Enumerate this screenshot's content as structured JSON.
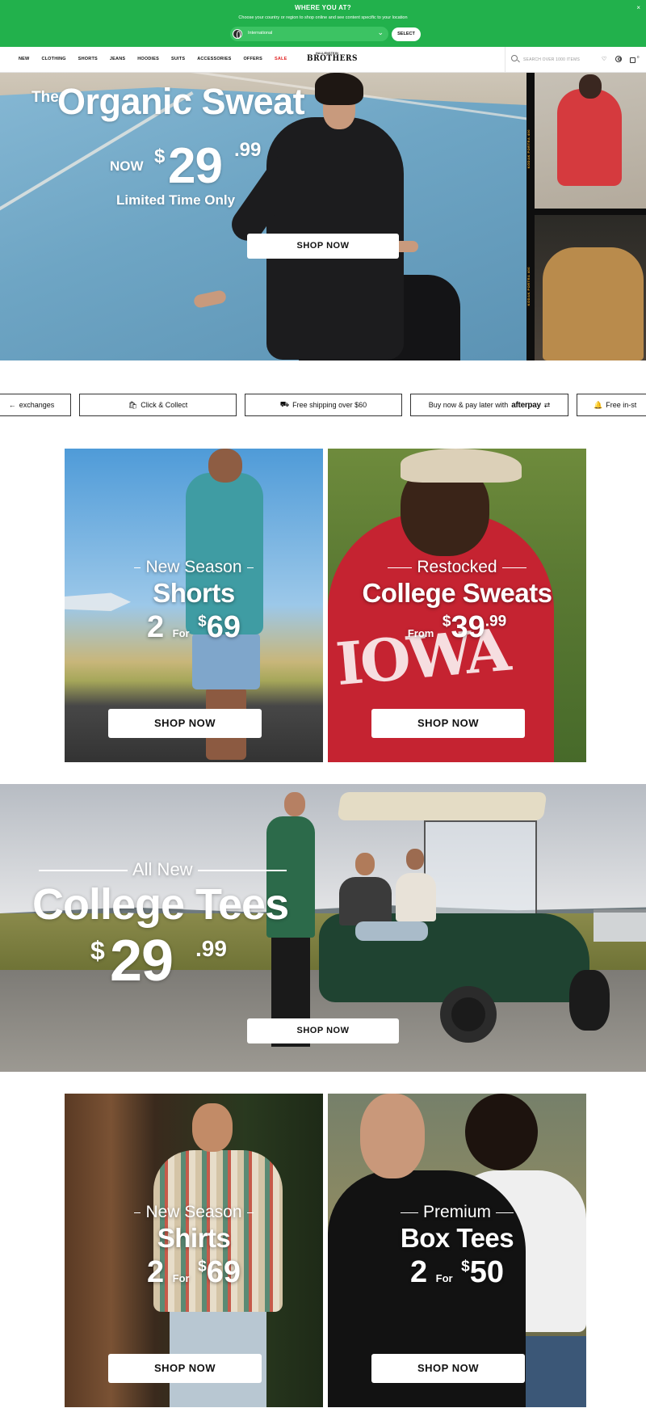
{
  "geo_banner": {
    "title": "WHERE YOU AT?",
    "subtitle": "Choose your country or region to shop online and see content specific to your location",
    "selected_region": "International",
    "select_button": "SELECT",
    "close": "×",
    "bg_color": "#22b14c"
  },
  "header": {
    "nav": [
      {
        "label": "NEW"
      },
      {
        "label": "CLOTHING"
      },
      {
        "label": "SHORTS"
      },
      {
        "label": "JEANS"
      },
      {
        "label": "HOODIES"
      },
      {
        "label": "SUITS"
      },
      {
        "label": "ACCESSORIES"
      },
      {
        "label": "OFFERS"
      },
      {
        "label": "SALE",
        "color": "#e02323"
      }
    ],
    "logo_small": "HALLENSTEIN",
    "logo_big": "BROTHERS",
    "search_placeholder": "SEARCH OVER 1000 ITEMS",
    "cart_count": "0"
  },
  "hero": {
    "the": "The",
    "title": "Organic Sweat",
    "now": "NOW",
    "dollar": "$",
    "price": "29",
    "cents": ".99",
    "subtitle": "Limited Time Only",
    "button": "SHOP NOW",
    "film_label_1": "KODAK PORTRA 400",
    "film_label_2": "KODAK PORTRA 400"
  },
  "usp": {
    "exchanges": "exchanges",
    "click_collect": "Click & Collect",
    "free_shipping": "Free shipping over $60",
    "buy_now": "Buy now & pay later with",
    "afterpay": "afterpay",
    "free_instore": "Free in-st"
  },
  "tiles": {
    "shorts": {
      "kicker": "New Season",
      "head": "Shorts",
      "qty": "2",
      "for": "For",
      "dollar": "$",
      "price": "69",
      "button": "SHOP NOW"
    },
    "sweats": {
      "kicker": "Restocked",
      "head": "College Sweats",
      "from": "From",
      "dollar": "$",
      "price": "39",
      "cents": ".99",
      "button": "SHOP NOW"
    },
    "tees": {
      "kicker": "All New",
      "head": "College Tees",
      "dollar": "$",
      "price": "29",
      "cents": ".99",
      "button": "SHOP NOW"
    },
    "shirts": {
      "kicker": "New Season",
      "head": "Shirts",
      "qty": "2",
      "for": "For",
      "dollar": "$",
      "price": "69",
      "button": "SHOP NOW"
    },
    "boxtees": {
      "kicker": "Premium",
      "head": "Box Tees",
      "qty": "2",
      "for": "For",
      "dollar": "$",
      "price": "50",
      "button": "SHOP NOW"
    }
  }
}
